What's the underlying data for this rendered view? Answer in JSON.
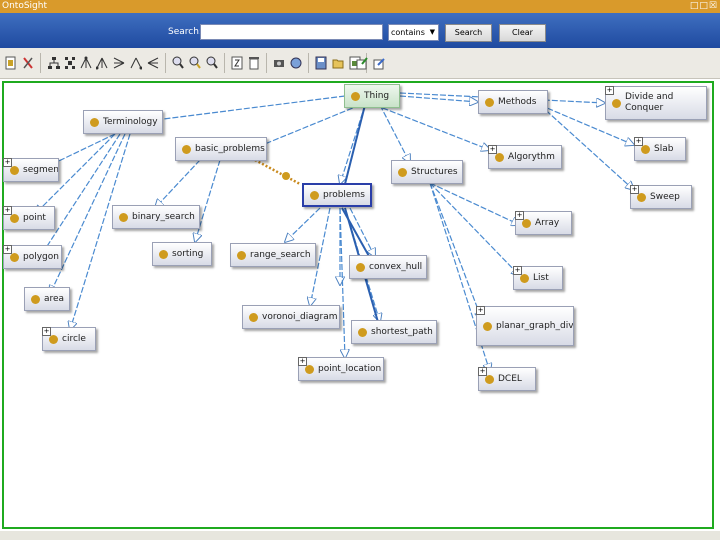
{
  "window": {
    "title": "OntoSight",
    "controls": "□□☒"
  },
  "search": {
    "label": "Search:",
    "value": "",
    "mode": "contains",
    "search_button": "Search",
    "clear_button": "Clear"
  },
  "toolbar": {
    "icons": [
      "file-icon",
      "cut-icon",
      "hierarchy-icon",
      "hierarchy-alt-icon",
      "tree-icon",
      "tree-left-icon",
      "tree-alt-icon",
      "tree-left-alt-icon",
      "zoom-in-icon",
      "zoom-fit-icon",
      "zoom-out-icon",
      "sort-az-icon",
      "delete-icon",
      "camera-icon",
      "preferences-icon",
      "save-icon",
      "open-icon",
      "export-icon",
      "import-icon"
    ]
  },
  "graph": {
    "root": "Thing",
    "nodes": {
      "thing": "Thing",
      "terminology": "Terminology",
      "methods": "Methods",
      "divide": "Divide and Conquer",
      "basic_problems": "basic_problems",
      "algorithm": "Algorythm",
      "slab": "Slab",
      "sweep": "Sweep",
      "structures": "Structures",
      "problems": "problems",
      "segment": "segment",
      "point": "point",
      "polygon": "polygon",
      "area": "area",
      "circle": "circle",
      "binary_search": "binary_search",
      "sorting": "sorting",
      "range_search": "range_search",
      "convex_hull": "convex_hull",
      "voronoi": "voronoi_diagram",
      "shortest_path": "shortest_path",
      "point_location": "point_location",
      "array": "Array",
      "list": "List",
      "planar": "planar_graph_division",
      "dcel": "DCEL"
    }
  }
}
